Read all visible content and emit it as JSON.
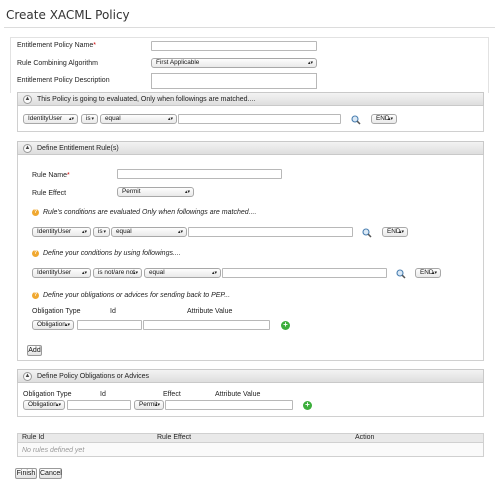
{
  "page": {
    "title": "Create XACML Policy"
  },
  "policy_form": {
    "name_label": "Entitlement Policy Name",
    "required_mark": "*",
    "algorithm_label": "Rule Combining Algorithm",
    "algorithm_value": "First Applicable",
    "description_label": "Entitlement Policy Description"
  },
  "target_section": {
    "title": "This Policy is going to evaluated, Only when followings are matched....",
    "attribute": "IdentityUser",
    "operator": "is",
    "function": "equal",
    "end": "END"
  },
  "rule_section": {
    "title": "Define Entitlement Rule(s)",
    "rule_name_label": "Rule Name",
    "rule_effect_label": "Rule Effect",
    "rule_effect_value": "Permit",
    "rule_target_hint": "Rule's conditions are evaluated Only when followings are matched....",
    "target_attribute": "IdentityUser",
    "target_operator": "is",
    "target_function": "equal",
    "target_end": "END",
    "condition_hint": "Define your conditions by using followings....",
    "condition_attribute": "IdentityUser",
    "condition_operator": "is not/are not",
    "condition_function": "equal",
    "condition_end": "END",
    "obligation_hint": "Define your obligations or advices for sending back to PEP...",
    "col_type": "Obligation Type",
    "col_id": "Id",
    "col_attr": "Attribute Value",
    "type_value": "Obligation",
    "add_label": "Add"
  },
  "policy_obligations": {
    "title": "Define Policy Obligations or Advices",
    "col_type": "Obligation Type",
    "col_id": "Id",
    "col_effect": "Effect",
    "col_attr": "Attribute Value",
    "type_value": "Obligation",
    "effect_value": "Permit"
  },
  "rules_table": {
    "headers": [
      "Rule Id",
      "Rule Effect",
      "Action"
    ],
    "empty_text": "No rules defined yet"
  },
  "actions": {
    "finish": "Finish",
    "cancel": "Cancel"
  },
  "icons": {
    "collapse": "chevron-up-icon",
    "help": "help-icon",
    "search": "magnifier-icon",
    "add": "plus-icon",
    "dropdown": "dropdown-arrow-icon"
  },
  "colors": {
    "help": "#f0a830",
    "add": "#3cae3c",
    "required": "#cc0000"
  }
}
